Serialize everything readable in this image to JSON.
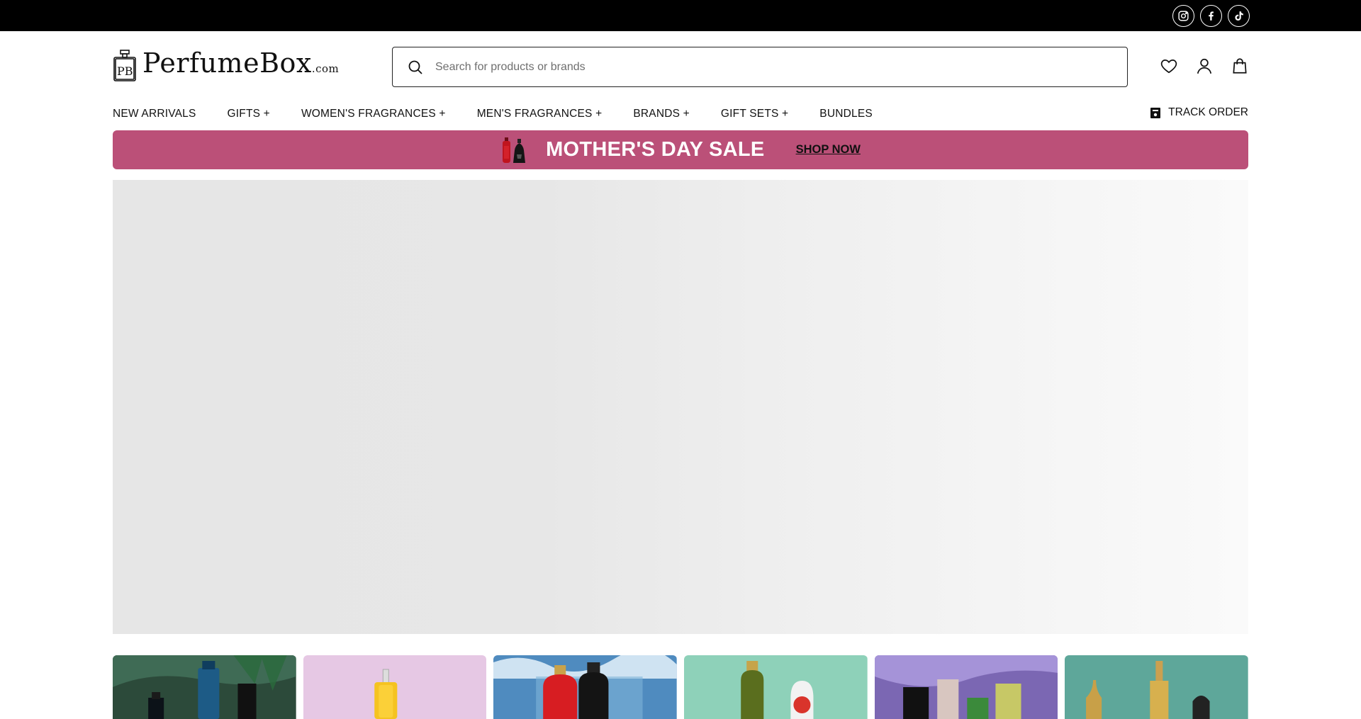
{
  "social": {
    "items": [
      {
        "icon": "instagram-icon"
      },
      {
        "icon": "facebook-icon"
      },
      {
        "icon": "tiktok-icon"
      }
    ]
  },
  "header": {
    "logo_text": "PerfumeBox",
    "logo_suffix": ".com",
    "logo_monogram": "PB",
    "search_placeholder": "Search for products or brands",
    "search_value": "",
    "icons": [
      "heart-icon",
      "user-icon",
      "bag-icon"
    ]
  },
  "nav": {
    "items": [
      {
        "label": "NEW ARRIVALS"
      },
      {
        "label": "GIFTS +"
      },
      {
        "label": "WOMEN'S FRAGRANCES +"
      },
      {
        "label": "MEN'S FRAGRANCES +"
      },
      {
        "label": "BRANDS +"
      },
      {
        "label": "GIFT SETS +"
      },
      {
        "label": "BUNDLES"
      }
    ],
    "track_order": "TRACK ORDER"
  },
  "promo": {
    "title": "MOTHER'S DAY SALE",
    "cta": "SHOP NOW",
    "background": "#bb5078"
  },
  "colors": {
    "topbar": "#000000",
    "text": "#111111",
    "hero_placeholder": "#e6e6e6"
  },
  "tiles": [
    {
      "theme": "dark-green bottles"
    },
    {
      "theme": "lilac yellow bottle"
    },
    {
      "theme": "blue red-black bottles"
    },
    {
      "theme": "mint olive bottles"
    },
    {
      "theme": "purple assorted bottles"
    },
    {
      "theme": "teal gold bottles"
    }
  ]
}
